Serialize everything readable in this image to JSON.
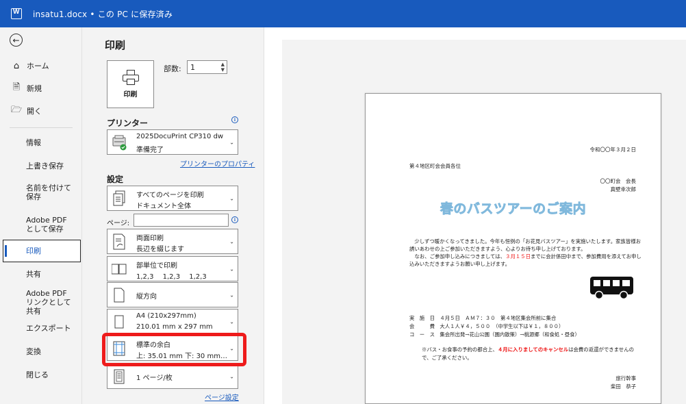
{
  "titlebar": {
    "doc_title": "insatu1.docx • この PC に保存済み"
  },
  "sidebar": {
    "home": "ホーム",
    "new": "新規",
    "open": "開く",
    "info": "情報",
    "save": "上書き保存",
    "save_as": "名前を付けて保存",
    "adobe_save": "Adobe PDF として保存",
    "print": "印刷",
    "share": "共有",
    "adobe_share": "Adobe PDF リンクとして共有",
    "export": "エクスポート",
    "transform": "変換",
    "close": "閉じる"
  },
  "settings": {
    "heading": "印刷",
    "print_button": "印刷",
    "copies_label": "部数:",
    "copies_value": "1",
    "printer_title": "プリンター",
    "printer_name": "2025DocuPrint CP310 dw",
    "printer_status": "準備完了",
    "printer_props": "プリンターのプロパティ",
    "settings_title": "設定",
    "range_main": "すべてのページを印刷",
    "range_sub": "ドキュメント全体",
    "pages_label": "ページ:",
    "pages_value": "",
    "duplex_main": "両面印刷",
    "duplex_sub": "長辺を綴じます",
    "collate_main": "部単位で印刷",
    "collate_sub": "1,2,3　 1,2,3　 1,2,3",
    "orientation": "縦方向",
    "size_main": "A4 (210x297mm)",
    "size_sub": "210.01 mm x 297 mm",
    "margin_main": "標準の余白",
    "margin_sub": "上: 35.01 mm 下: 30 mm…",
    "persheet": "1 ページ/枚",
    "page_setup": "ページ設定"
  },
  "document": {
    "date": "令和〇〇年３月２日",
    "to": "第４地区町会会員各位",
    "from1": "〇〇町会　会長",
    "from2": "真壁幸次郎",
    "title": "春のバスツアーのご案内",
    "p1": "　少しずつ暖かくなってきました。今年も恒例の「お花見バスツアー」を実施いたします。家族皆様お誘いあわせの上ご参加いただきますよう、心よりお待ち申し上げております。",
    "p2_pre": "　なお、ご参加申し込みにつきましては、",
    "p2_red": "３月１５日",
    "p2_post": "までに会計係田中まで、参加費用を添えてお申し込みいただきますようお願い申し上げます。",
    "d1": "実　施　日　４月５日　ＡＭ７：３０　第４地区集会所前に集合",
    "d2": "会　　　費　大人１人￥４，５００　（中学生以下は￥１，８００）",
    "d3": "コ　ー　ス　集会所出発→花山公園（園内散策）→桃源郷（和食処・昼食）",
    "note_pre": "※バス・お食事の予約の都合上、",
    "note_red": "４月に入りましてのキャンセル",
    "note_post": "は会費の返還ができませんので、ご了承ください。",
    "sig1": "旅行幹事",
    "sig2": "柴田　恭子"
  },
  "colors": {
    "accent": "#185abd",
    "highlight": "#ee1b1b",
    "title_fill": "#bfe3f7"
  }
}
